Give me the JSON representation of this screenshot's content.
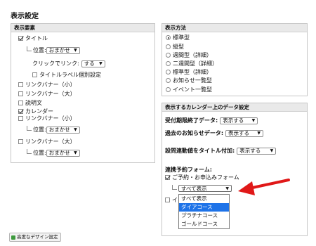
{
  "page_title": "表示設定",
  "left_panel": {
    "header": "表示要素",
    "items": {
      "title_check": "タイトル",
      "position_label": "位置:",
      "auto": "おまかせ",
      "click_link_label": "クリックでリンク:",
      "click_link_value": "する",
      "title_label_individual": "タイトルラベル個別設定",
      "link_banner_small": "リンクバナー（小）",
      "link_banner_large": "リンクバナー（大）",
      "description": "説明文",
      "calendar": "カレンダー",
      "link_banner_small_2": "リンクバナー（小）",
      "link_banner_large_2": "リンクバナー（大）"
    }
  },
  "right_top_panel": {
    "header": "表示方法",
    "options": [
      "標準型",
      "縦型",
      "週間型（詳細）",
      "二週間型（詳細）",
      "標準型（詳細）",
      "お知らせ一覧型",
      "イベント一覧型"
    ]
  },
  "right_bottom_panel": {
    "header": "表示するカレンダー上のデータ設定",
    "reception_label": "受付期限終了データ:",
    "reception_value": "表示する",
    "past_news_label": "過去のお知らせデータ:",
    "past_news_value": "表示する",
    "motive_label": "設問連動値をタイトル付加:",
    "motive_value": "表示する",
    "linked_form_label": "連携予約フォーム:",
    "reservation_form": "ご予約・お申込みフォーム",
    "selected": "すべて表示",
    "dropdown_options": [
      "すべて表示",
      "ダイアコース",
      "プラチナコース",
      "ゴールドコース"
    ],
    "partial_char": "イ"
  },
  "footer_button": "高度なデザイン設定",
  "colors": {
    "arrow": "#e01818",
    "highlight": "#1e73e8"
  }
}
